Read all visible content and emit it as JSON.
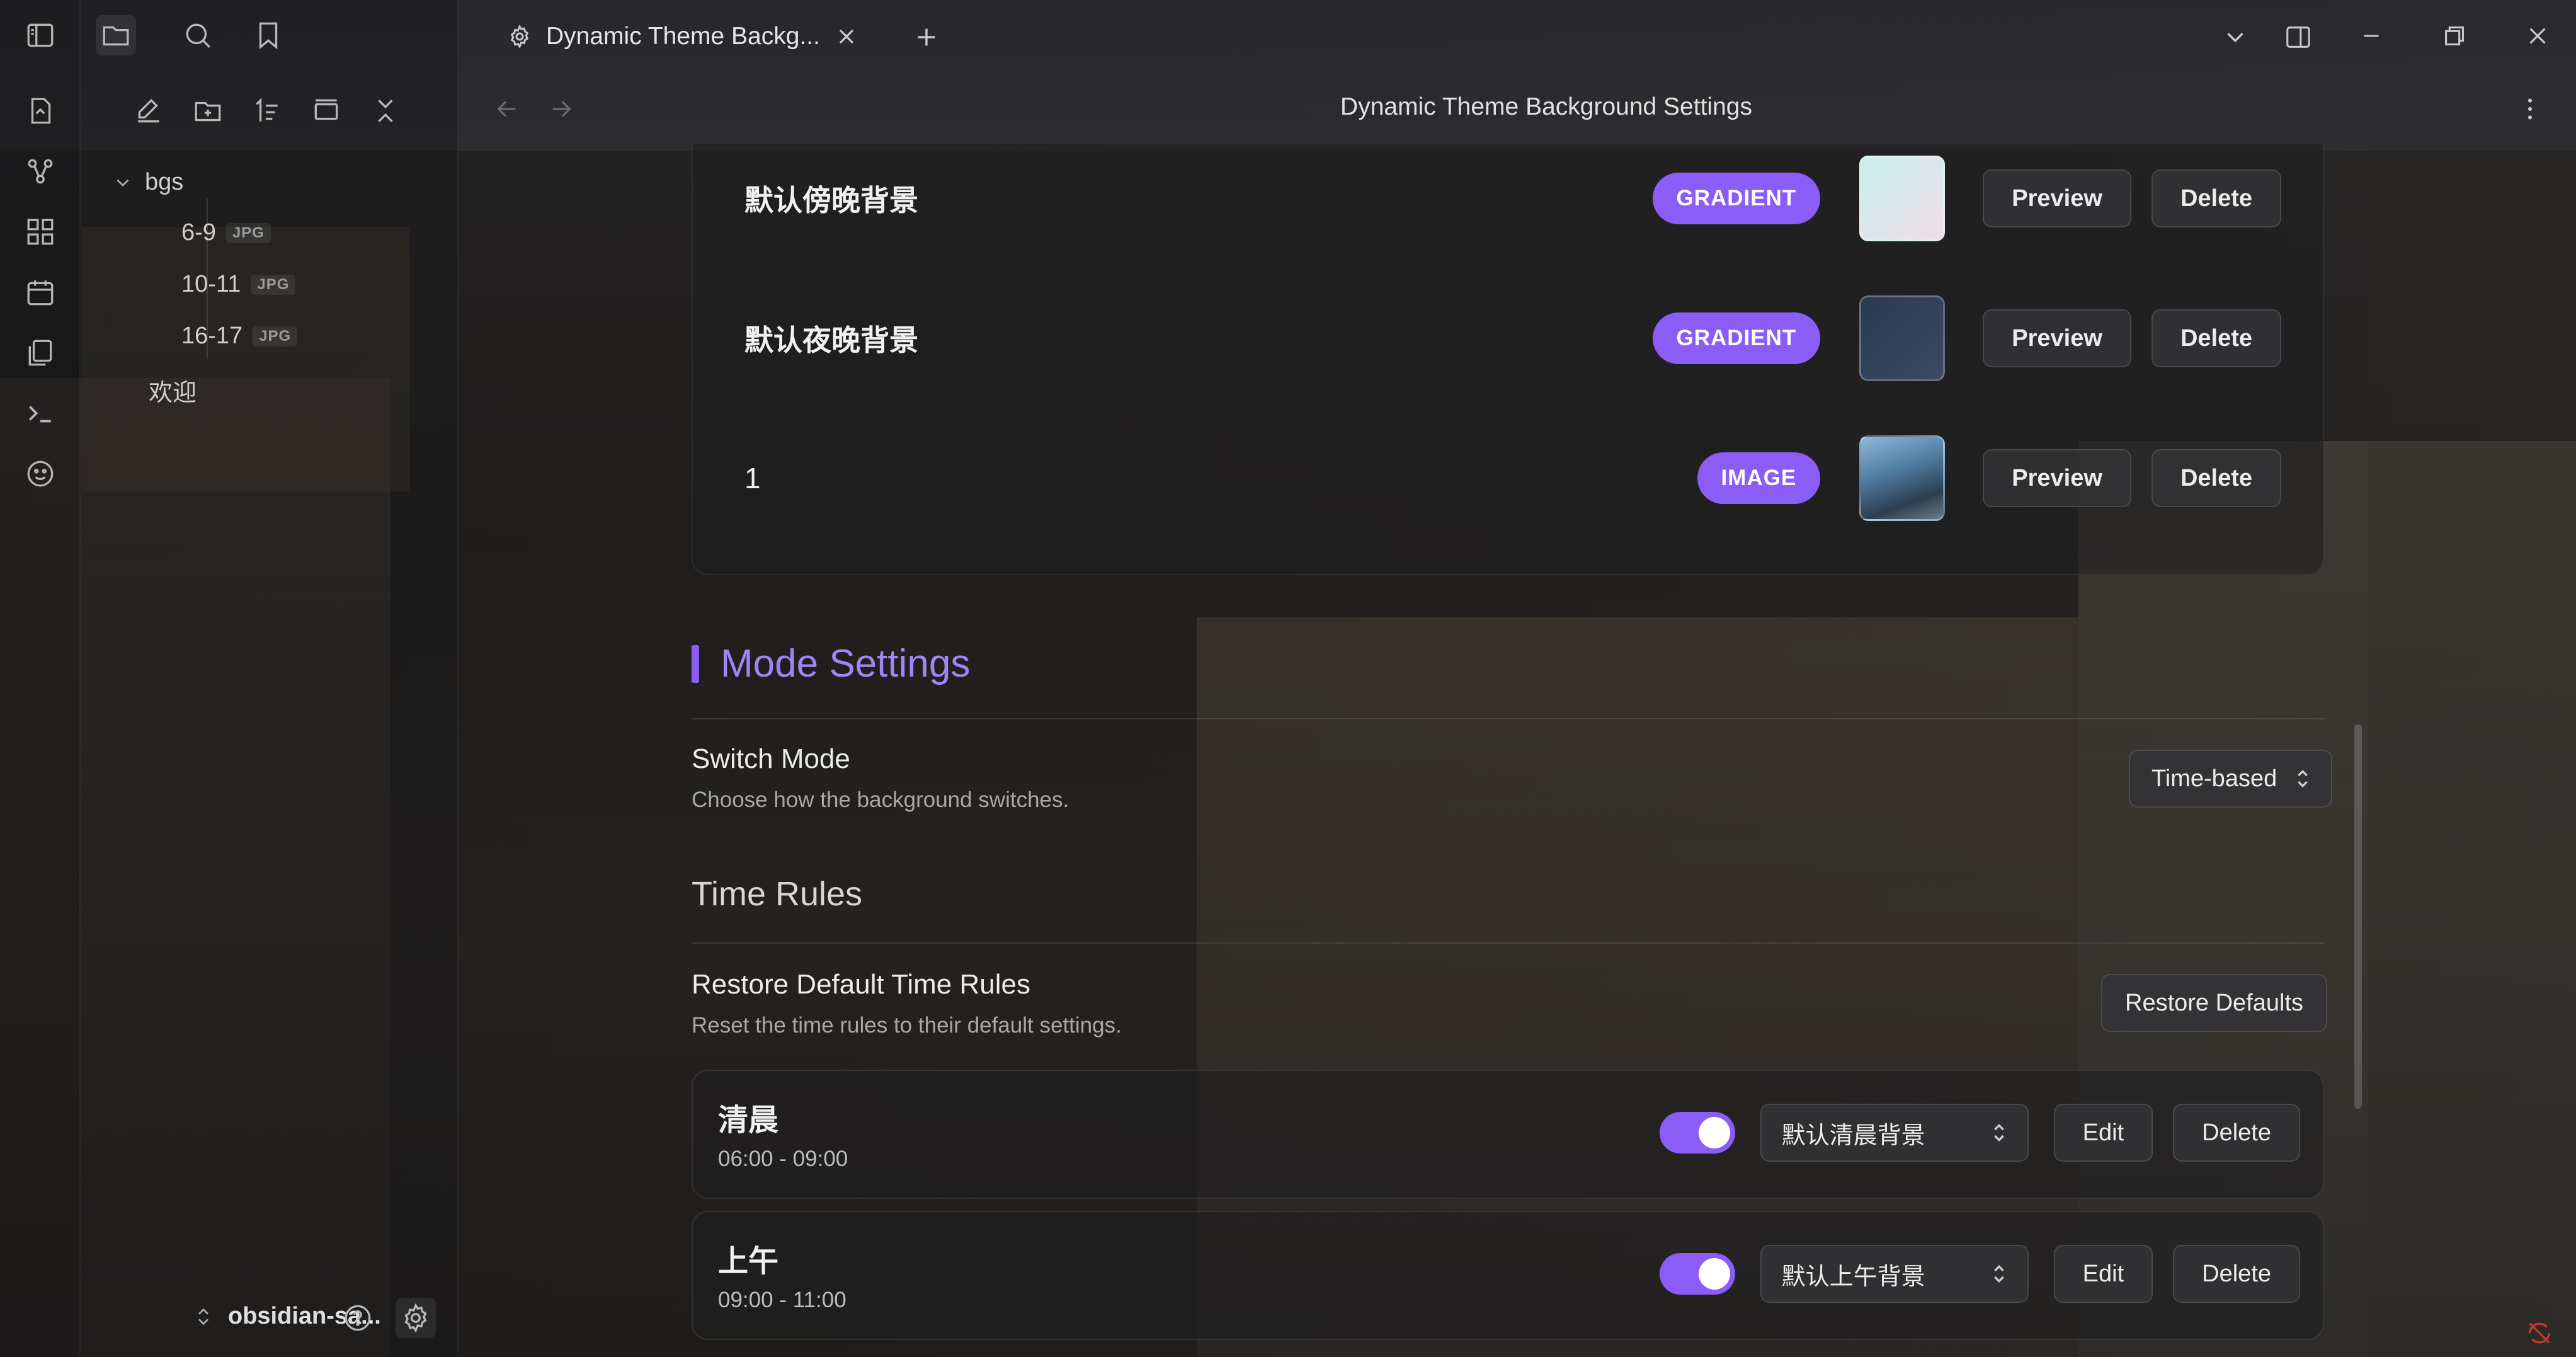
{
  "window": {
    "tab_title": "Dynamic Theme Backg...",
    "view_title": "Dynamic Theme Background Settings"
  },
  "sidebar": {
    "tree": [
      {
        "label": "bgs",
        "type": "folder"
      },
      {
        "label": "6-9",
        "ext": "JPG"
      },
      {
        "label": "10-11",
        "ext": "JPG"
      },
      {
        "label": "16-17",
        "ext": "JPG"
      },
      {
        "label": "欢迎",
        "type": "file"
      }
    ],
    "vault_name": "obsidian-sa..."
  },
  "backgrounds": [
    {
      "name": "默认傍晚背景",
      "type": "GRADIENT",
      "swatch": "#d8ecf0"
    },
    {
      "name": "默认夜晚背景",
      "type": "GRADIENT",
      "swatch": "#2f3d55"
    },
    {
      "name": "1",
      "type": "IMAGE",
      "swatch": "#4f7ea3"
    }
  ],
  "buttons": {
    "preview": "Preview",
    "delete": "Delete",
    "edit": "Edit",
    "restore": "Restore Defaults"
  },
  "mode_settings": {
    "title": "Mode Settings",
    "switch_mode": {
      "name": "Switch Mode",
      "desc": "Choose how the background switches.",
      "value": "Time-based"
    },
    "time_rules_heading": "Time Rules",
    "restore": {
      "name": "Restore Default Time Rules",
      "desc": "Reset the time rules to their default settings."
    }
  },
  "time_rules": [
    {
      "name": "清晨",
      "time": "06:00 - 09:00",
      "enabled": true,
      "background": "默认清晨背景"
    },
    {
      "name": "上午",
      "time": "09:00 - 11:00",
      "enabled": true,
      "background": "默认上午背景"
    }
  ],
  "colors": {
    "accent": "#8b5cf6",
    "accent_text": "#9f86f7"
  }
}
